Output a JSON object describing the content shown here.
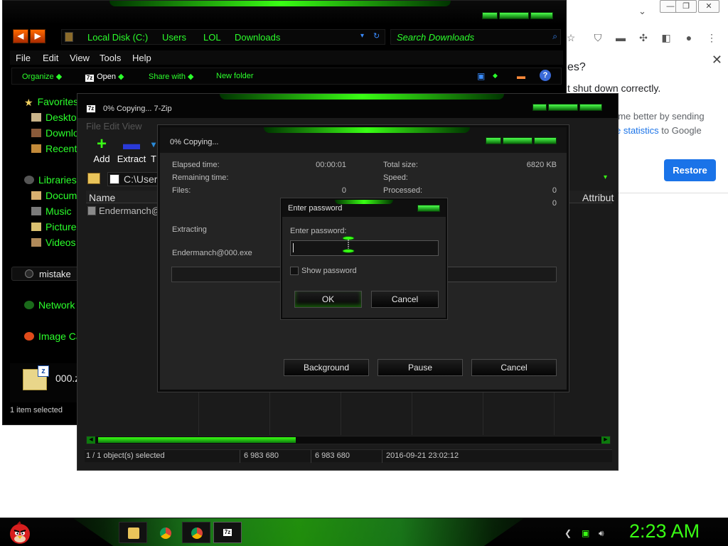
{
  "chrome": {
    "panel_title_partial": "es?",
    "panel_msg_partial": "t shut down correctly.",
    "panel_help_partial1": "ome better by sending",
    "panel_help_link": "e statistics",
    "panel_help_partial2": " to Google",
    "restore_label": "Restore",
    "min_glyph": "—",
    "max_glyph": "❐",
    "close_glyph": "✕",
    "collapse_glyph": "⌄"
  },
  "explorer": {
    "breadcrumbs": [
      "Local Disk (C:)",
      "Users",
      "LOL",
      "Downloads"
    ],
    "search_placeholder": "Search Downloads",
    "menu": [
      "File",
      "Edit",
      "View",
      "Tools",
      "Help"
    ],
    "commands": {
      "organize": "Organize",
      "open": "Open",
      "share": "Share with",
      "new_folder": "New folder"
    },
    "nav": {
      "favorites": "Favorites",
      "desktop": "Desktop",
      "downloads": "Downloads",
      "recent": "Recent",
      "libraries": "Libraries",
      "documents": "Documents",
      "music": "Music",
      "pictures": "Pictures",
      "videos": "Videos",
      "homegroup": "mistake",
      "network": "Network",
      "image": "Image Capture"
    },
    "details_name": "000.z",
    "status": "1 item selected"
  },
  "sevenzip": {
    "title": "0% Copying... 7-Zip",
    "menu_partial": "File  Edit  View",
    "tools": {
      "add": "Add",
      "extract": "Extract",
      "test": "T"
    },
    "path_partial": "C:\\User",
    "col_name": "Name",
    "col_attrib": "Attribut",
    "row_name": "Endermanch@",
    "status": {
      "selected": "1 / 1 object(s) selected",
      "size": "6 983 680",
      "packed": "6 983 680",
      "modified": "2016-09-21 23:02:12"
    }
  },
  "progress": {
    "title": "0% Copying...",
    "elapsed_label": "Elapsed time:",
    "elapsed_value": "00:00:01",
    "remaining_label": "Remaining time:",
    "files_label": "Files:",
    "files_value": "0",
    "total_label": "Total size:",
    "total_value": "6820 KB",
    "speed_label": "Speed:",
    "processed_label": "Processed:",
    "processed_value": "0",
    "extra_value": "0",
    "action": "Extracting",
    "file": "Endermanch@000.exe",
    "btn_background": "Background",
    "btn_pause": "Pause",
    "btn_cancel": "Cancel"
  },
  "password": {
    "title": "Enter password",
    "label": "Enter password:",
    "value": "",
    "show_label": "Show password",
    "ok": "OK",
    "cancel": "Cancel"
  },
  "taskbar": {
    "clock": "2:23 AM"
  },
  "colors": {
    "accent": "#39ff14",
    "chrome_blue": "#1a73e8",
    "dark_bg": "#1b1b1b"
  }
}
